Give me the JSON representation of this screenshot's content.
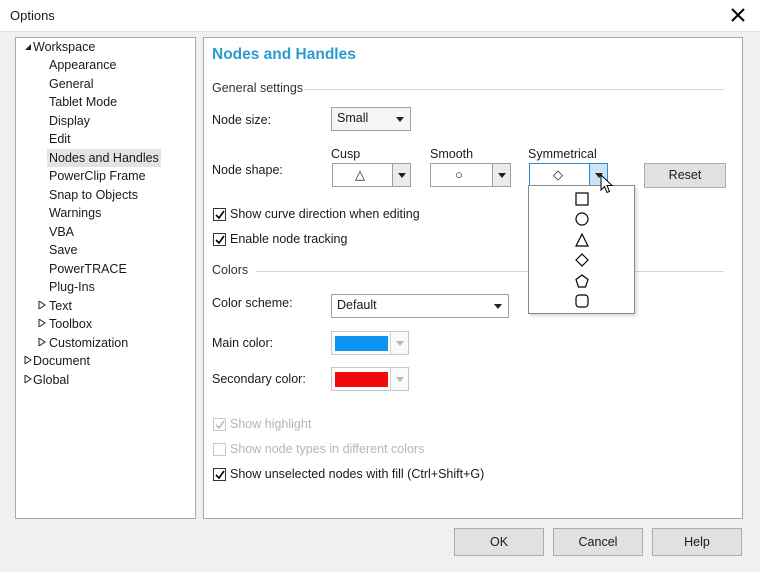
{
  "window": {
    "title": "Options"
  },
  "tree": {
    "items": [
      {
        "label": "Workspace",
        "expander": "expanded-triangle-icon"
      },
      {
        "label": "Appearance"
      },
      {
        "label": "General"
      },
      {
        "label": "Tablet Mode"
      },
      {
        "label": "Display"
      },
      {
        "label": "Edit"
      },
      {
        "label": "Nodes and Handles",
        "selected": true
      },
      {
        "label": "PowerClip Frame"
      },
      {
        "label": "Snap to Objects"
      },
      {
        "label": "Warnings"
      },
      {
        "label": "VBA"
      },
      {
        "label": "Save"
      },
      {
        "label": "PowerTRACE"
      },
      {
        "label": "Plug-Ins"
      },
      {
        "label": "Text",
        "expander": "collapsed-triangle-icon"
      },
      {
        "label": "Toolbox",
        "expander": "collapsed-triangle-icon"
      },
      {
        "label": "Customization",
        "expander": "collapsed-triangle-icon"
      },
      {
        "label": "Document",
        "expander": "collapsed-triangle-icon"
      },
      {
        "label": "Global",
        "expander": "collapsed-triangle-icon"
      }
    ]
  },
  "page": {
    "title": "Nodes and Handles",
    "general_settings": {
      "heading": "General settings",
      "node_size_label": "Node size:",
      "node_size_value": "Small",
      "node_shape_label": "Node shape:",
      "cusp_label": "Cusp",
      "smooth_label": "Smooth",
      "symmetrical_label": "Symmetrical",
      "cusp_glyph": "△",
      "smooth_glyph": "○",
      "symmetrical_glyph": "◇",
      "reset_label": "Reset",
      "show_curve_direction": {
        "label": "Show curve direction when editing",
        "checked": true
      },
      "enable_node_tracking": {
        "label": "Enable node tracking",
        "checked": true
      }
    },
    "colors": {
      "heading": "Colors",
      "color_scheme_label": "Color scheme:",
      "color_scheme_value": "Default",
      "main_color_label": "Main color:",
      "main_color": "#0b95f0",
      "secondary_color_label": "Secondary color:",
      "secondary_color": "#f00b0b",
      "show_highlight": {
        "label": "Show highlight",
        "checked": true,
        "disabled": true
      },
      "show_node_types": {
        "label": "Show node types in different colors",
        "checked": false,
        "disabled": true
      },
      "show_unselected_fill": {
        "label": "Show unselected nodes with fill (Ctrl+Shift+G)",
        "checked": true
      }
    },
    "shape_dropdown": {
      "options": [
        "square",
        "circle",
        "triangle",
        "diamond",
        "pentagon",
        "rounded-square"
      ]
    }
  },
  "footer": {
    "ok_label": "OK",
    "cancel_label": "Cancel",
    "help_label": "Help"
  },
  "colors": {
    "accent": "#2b9bd3",
    "selection_bg": "#e3e3e3",
    "focus_border": "#2e86d8"
  }
}
